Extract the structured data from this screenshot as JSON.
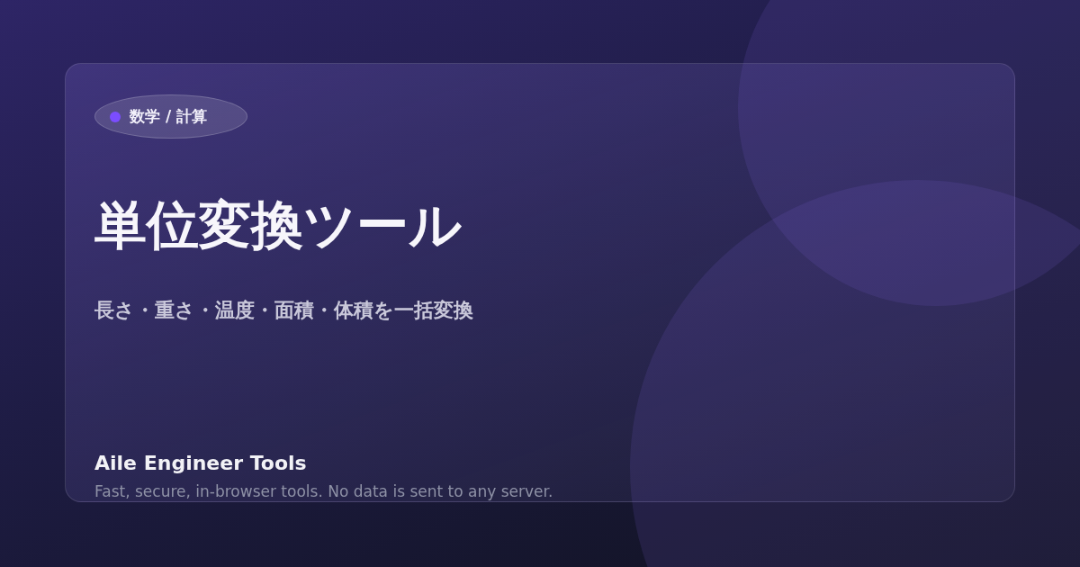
{
  "category_badge": {
    "label": "数学 / 計算"
  },
  "title": "単位変換ツール",
  "subtitle": "長さ・重さ・温度・面積・体積を一括変換",
  "footer": {
    "brand": "Aile Engineer Tools",
    "tagline": "Fast, secure, in-browser tools. No data is sent to any server."
  }
}
